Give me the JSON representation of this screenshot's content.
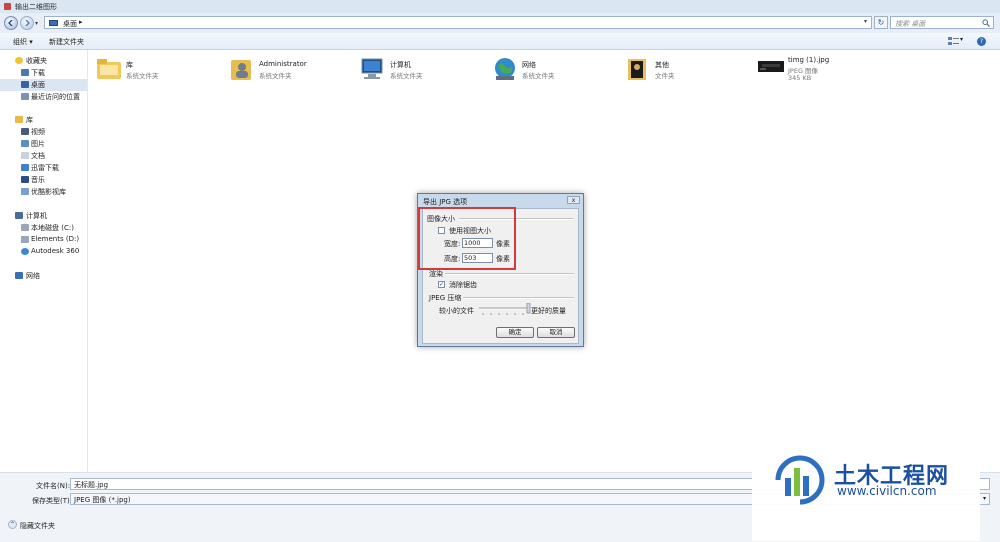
{
  "window": {
    "title": "输出二维图形"
  },
  "address": {
    "crumb": "桌面",
    "crumb_arrow": "▸",
    "dropdown": "▾",
    "search_placeholder": "搜索 桌面"
  },
  "toolbar": {
    "organize": "组织 ▾",
    "new_folder": "新建文件夹",
    "view_dropdown": "▾",
    "help": "?"
  },
  "sidebar": {
    "items": [
      {
        "label": "收藏夹",
        "icon": "star-icon"
      },
      {
        "label": "下载",
        "icon": "download-folder-icon"
      },
      {
        "label": "桌面",
        "icon": "desktop-icon",
        "selected": true
      },
      {
        "label": "最近访问的位置",
        "icon": "recent-places-icon"
      },
      {
        "label": "库",
        "icon": "library-icon"
      },
      {
        "label": "视频",
        "icon": "video-icon"
      },
      {
        "label": "图片",
        "icon": "pictures-icon"
      },
      {
        "label": "文档",
        "icon": "documents-icon"
      },
      {
        "label": "迅雷下载",
        "icon": "thunder-download-icon"
      },
      {
        "label": "音乐",
        "icon": "music-icon"
      },
      {
        "label": "优酷影视库",
        "icon": "youku-library-icon"
      },
      {
        "label": "计算机",
        "icon": "computer-icon"
      },
      {
        "label": "本地磁盘 (C:)",
        "icon": "local-disk-icon"
      },
      {
        "label": "Elements (D:)",
        "icon": "drive-icon"
      },
      {
        "label": "Autodesk 360",
        "icon": "cloud-icon"
      },
      {
        "label": "网络",
        "icon": "network-icon"
      }
    ]
  },
  "files": [
    {
      "name": "库",
      "type": "系统文件夹",
      "size": "",
      "icon": "library-folder-icon"
    },
    {
      "name": "Administrator",
      "type": "系统文件夹",
      "size": "",
      "icon": "user-folder-icon"
    },
    {
      "name": "计算机",
      "type": "系统文件夹",
      "size": "",
      "icon": "computer-icon"
    },
    {
      "name": "网络",
      "type": "系统文件夹",
      "size": "",
      "icon": "network-globe-icon"
    },
    {
      "name": "其他",
      "type": "文件夹",
      "size": "",
      "icon": "folder-icon"
    },
    {
      "name": "timg (1).jpg",
      "type": "JPEG 图像",
      "size": "345 KB",
      "icon": "jpg-thumbnail-icon"
    }
  ],
  "bottom": {
    "filename_label": "文件名(N):",
    "filename_value": "无标题.jpg",
    "filetype_label": "保存类型(T):",
    "filetype_value": "JPEG 图像 (*.jpg)",
    "hide_folders": "隐藏文件夹"
  },
  "dialog": {
    "title": "导出 JPG 选项",
    "close": "x",
    "image_size_group": "图像大小",
    "use_view_size": "使用视图大小",
    "width_label": "宽度:",
    "width_value": "1000",
    "width_unit": "像素",
    "height_label": "高度:",
    "height_value": "503",
    "height_unit": "像素",
    "render_group": "渲染",
    "antialias": "消除锯齿",
    "compression_group": "JPEG 压缩",
    "smaller_file": "较小的文件",
    "better_quality": "更好的质量",
    "ok": "确定",
    "cancel": "取消"
  },
  "watermark": {
    "brand": "土木工程网",
    "url": "www.civilcn.com"
  },
  "colors": {
    "highlight_box": "#d33b3b",
    "accent": "#2e6ab4",
    "selection": "#dbe6f3"
  }
}
